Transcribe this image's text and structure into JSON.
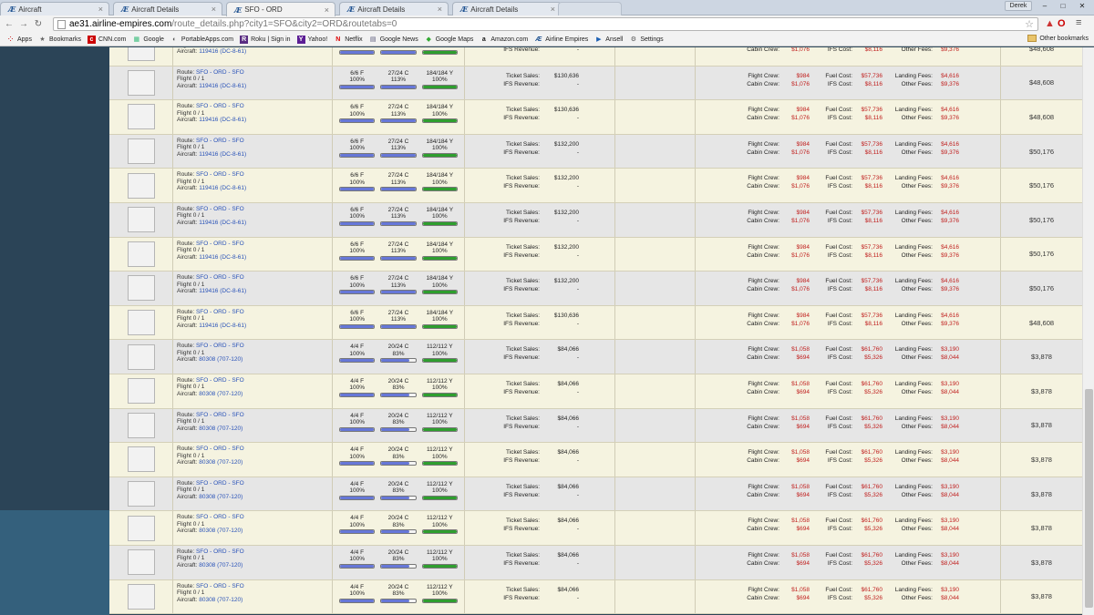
{
  "tabs": [
    {
      "label": "Aircraft",
      "active": false
    },
    {
      "label": "Aircraft Details",
      "active": false
    },
    {
      "label": "SFO - ORD",
      "active": true
    },
    {
      "label": "Aircraft Details",
      "active": false
    },
    {
      "label": "Aircraft Details",
      "active": false
    }
  ],
  "window": {
    "user": "Derek",
    "minimize": "–",
    "maximize": "□",
    "close": "✕"
  },
  "address": {
    "host": "ae31.airline-empires.com",
    "path": "/route_details.php?city1=SFO&city2=ORD&routetabs=0"
  },
  "bookmarks": [
    {
      "label": "Apps",
      "icon": "apps-icon"
    },
    {
      "label": "Bookmarks",
      "icon": "star-icon"
    },
    {
      "label": "CNN.com",
      "icon": "cnn-icon"
    },
    {
      "label": "Google",
      "icon": "google-icon"
    },
    {
      "label": "PortableApps.com",
      "icon": "portableapps-icon"
    },
    {
      "label": "Roku | Sign in",
      "icon": "roku-icon"
    },
    {
      "label": "Yahoo!",
      "icon": "yahoo-icon"
    },
    {
      "label": "Netflix",
      "icon": "netflix-icon"
    },
    {
      "label": "Google News",
      "icon": "news-icon"
    },
    {
      "label": "Google Maps",
      "icon": "maps-icon"
    },
    {
      "label": "Amazon.com",
      "icon": "amazon-icon"
    },
    {
      "label": "Airline Empires",
      "icon": "ae-icon"
    },
    {
      "label": "Ansell",
      "icon": "ansell-icon"
    },
    {
      "label": "Settings",
      "icon": "gear-icon"
    }
  ],
  "other_bookmarks": "Other bookmarks",
  "labels": {
    "route": "Route:",
    "flight": "Flight",
    "aircraft": "Aircraft:",
    "ticket_sales": "Ticket Sales:",
    "ifs_revenue": "IFS Revenue:",
    "flight_crew": "Flight Crew:",
    "cabin_crew": "Cabin Crew:",
    "fuel_cost": "Fuel Cost:",
    "ifs_cost": "IFS Cost:",
    "landing_fees": "Landing Fees:",
    "other_fees": "Other Fees:"
  },
  "rows": [
    {
      "route": "SFO - ORD - SFO",
      "flight": "0 / 1",
      "aircraft": "119416 (DC-8-61)",
      "f": "6/6 F",
      "c": "27/24 C",
      "y": "184/184 Y",
      "fp": "100%",
      "cp": "113%",
      "yp": "100%",
      "fv": 1.0,
      "cv": 1.13,
      "yv": 1.0,
      "ticket": "$130,636",
      "ifs": "-",
      "fcrew": "$984",
      "ccrew": "$1,076",
      "fuel": "$57,736",
      "ifscost": "$8,116",
      "landing": "$4,616",
      "other": "$9,376",
      "profit": "$48,608"
    },
    {
      "route": "SFO - ORD - SFO",
      "flight": "0 / 1",
      "aircraft": "119416 (DC-8-61)",
      "f": "6/6 F",
      "c": "27/24 C",
      "y": "184/184 Y",
      "fp": "100%",
      "cp": "113%",
      "yp": "100%",
      "fv": 1.0,
      "cv": 1.13,
      "yv": 1.0,
      "ticket": "$130,636",
      "ifs": "-",
      "fcrew": "$984",
      "ccrew": "$1,076",
      "fuel": "$57,736",
      "ifscost": "$8,116",
      "landing": "$4,616",
      "other": "$9,376",
      "profit": "$48,608"
    },
    {
      "route": "SFO - ORD - SFO",
      "flight": "0 / 1",
      "aircraft": "119416 (DC-8-61)",
      "f": "6/6 F",
      "c": "27/24 C",
      "y": "184/184 Y",
      "fp": "100%",
      "cp": "113%",
      "yp": "100%",
      "fv": 1.0,
      "cv": 1.13,
      "yv": 1.0,
      "ticket": "$130,636",
      "ifs": "-",
      "fcrew": "$984",
      "ccrew": "$1,076",
      "fuel": "$57,736",
      "ifscost": "$8,116",
      "landing": "$4,616",
      "other": "$9,376",
      "profit": "$48,608"
    },
    {
      "route": "SFO - ORD - SFO",
      "flight": "0 / 1",
      "aircraft": "119416 (DC-8-61)",
      "f": "6/6 F",
      "c": "27/24 C",
      "y": "184/184 Y",
      "fp": "100%",
      "cp": "113%",
      "yp": "100%",
      "fv": 1.0,
      "cv": 1.13,
      "yv": 1.0,
      "ticket": "$132,200",
      "ifs": "-",
      "fcrew": "$984",
      "ccrew": "$1,076",
      "fuel": "$57,736",
      "ifscost": "$8,116",
      "landing": "$4,616",
      "other": "$9,376",
      "profit": "$50,176"
    },
    {
      "route": "SFO - ORD - SFO",
      "flight": "0 / 1",
      "aircraft": "119416 (DC-8-61)",
      "f": "6/6 F",
      "c": "27/24 C",
      "y": "184/184 Y",
      "fp": "100%",
      "cp": "113%",
      "yp": "100%",
      "fv": 1.0,
      "cv": 1.13,
      "yv": 1.0,
      "ticket": "$132,200",
      "ifs": "-",
      "fcrew": "$984",
      "ccrew": "$1,076",
      "fuel": "$57,736",
      "ifscost": "$8,116",
      "landing": "$4,616",
      "other": "$9,376",
      "profit": "$50,176"
    },
    {
      "route": "SFO - ORD - SFO",
      "flight": "0 / 1",
      "aircraft": "119416 (DC-8-61)",
      "f": "6/6 F",
      "c": "27/24 C",
      "y": "184/184 Y",
      "fp": "100%",
      "cp": "113%",
      "yp": "100%",
      "fv": 1.0,
      "cv": 1.13,
      "yv": 1.0,
      "ticket": "$132,200",
      "ifs": "-",
      "fcrew": "$984",
      "ccrew": "$1,076",
      "fuel": "$57,736",
      "ifscost": "$8,116",
      "landing": "$4,616",
      "other": "$9,376",
      "profit": "$50,176"
    },
    {
      "route": "SFO - ORD - SFO",
      "flight": "0 / 1",
      "aircraft": "119416 (DC-8-61)",
      "f": "6/6 F",
      "c": "27/24 C",
      "y": "184/184 Y",
      "fp": "100%",
      "cp": "113%",
      "yp": "100%",
      "fv": 1.0,
      "cv": 1.13,
      "yv": 1.0,
      "ticket": "$132,200",
      "ifs": "-",
      "fcrew": "$984",
      "ccrew": "$1,076",
      "fuel": "$57,736",
      "ifscost": "$8,116",
      "landing": "$4,616",
      "other": "$9,376",
      "profit": "$50,176"
    },
    {
      "route": "SFO - ORD - SFO",
      "flight": "0 / 1",
      "aircraft": "119416 (DC-8-61)",
      "f": "6/6 F",
      "c": "27/24 C",
      "y": "184/184 Y",
      "fp": "100%",
      "cp": "113%",
      "yp": "100%",
      "fv": 1.0,
      "cv": 1.13,
      "yv": 1.0,
      "ticket": "$132,200",
      "ifs": "-",
      "fcrew": "$984",
      "ccrew": "$1,076",
      "fuel": "$57,736",
      "ifscost": "$8,116",
      "landing": "$4,616",
      "other": "$9,376",
      "profit": "$50,176"
    },
    {
      "route": "SFO - ORD - SFO",
      "flight": "0 / 1",
      "aircraft": "119416 (DC-8-61)",
      "f": "6/6 F",
      "c": "27/24 C",
      "y": "184/184 Y",
      "fp": "100%",
      "cp": "113%",
      "yp": "100%",
      "fv": 1.0,
      "cv": 1.13,
      "yv": 1.0,
      "ticket": "$130,636",
      "ifs": "-",
      "fcrew": "$984",
      "ccrew": "$1,076",
      "fuel": "$57,736",
      "ifscost": "$8,116",
      "landing": "$4,616",
      "other": "$9,376",
      "profit": "$48,608"
    },
    {
      "route": "SFO - ORD - SFO",
      "flight": "0 / 1",
      "aircraft": "80308 (707-120)",
      "f": "4/4 F",
      "c": "20/24 C",
      "y": "112/112 Y",
      "fp": "100%",
      "cp": "83%",
      "yp": "100%",
      "fv": 1.0,
      "cv": 0.83,
      "yv": 1.0,
      "ticket": "$84,066",
      "ifs": "-",
      "fcrew": "$1,058",
      "ccrew": "$694",
      "fuel": "$61,760",
      "ifscost": "$5,326",
      "landing": "$3,190",
      "other": "$8,044",
      "profit": "$3,878"
    },
    {
      "route": "SFO - ORD - SFO",
      "flight": "0 / 1",
      "aircraft": "80308 (707-120)",
      "f": "4/4 F",
      "c": "20/24 C",
      "y": "112/112 Y",
      "fp": "100%",
      "cp": "83%",
      "yp": "100%",
      "fv": 1.0,
      "cv": 0.83,
      "yv": 1.0,
      "ticket": "$84,066",
      "ifs": "-",
      "fcrew": "$1,058",
      "ccrew": "$694",
      "fuel": "$61,760",
      "ifscost": "$5,326",
      "landing": "$3,190",
      "other": "$8,044",
      "profit": "$3,878"
    },
    {
      "route": "SFO - ORD - SFO",
      "flight": "0 / 1",
      "aircraft": "80308 (707-120)",
      "f": "4/4 F",
      "c": "20/24 C",
      "y": "112/112 Y",
      "fp": "100%",
      "cp": "83%",
      "yp": "100%",
      "fv": 1.0,
      "cv": 0.83,
      "yv": 1.0,
      "ticket": "$84,066",
      "ifs": "-",
      "fcrew": "$1,058",
      "ccrew": "$694",
      "fuel": "$61,760",
      "ifscost": "$5,326",
      "landing": "$3,190",
      "other": "$8,044",
      "profit": "$3,878"
    },
    {
      "route": "SFO - ORD - SFO",
      "flight": "0 / 1",
      "aircraft": "80308 (707-120)",
      "f": "4/4 F",
      "c": "20/24 C",
      "y": "112/112 Y",
      "fp": "100%",
      "cp": "83%",
      "yp": "100%",
      "fv": 1.0,
      "cv": 0.83,
      "yv": 1.0,
      "ticket": "$84,066",
      "ifs": "-",
      "fcrew": "$1,058",
      "ccrew": "$694",
      "fuel": "$61,760",
      "ifscost": "$5,326",
      "landing": "$3,190",
      "other": "$8,044",
      "profit": "$3,878"
    },
    {
      "route": "SFO - ORD - SFO",
      "flight": "0 / 1",
      "aircraft": "80308 (707-120)",
      "f": "4/4 F",
      "c": "20/24 C",
      "y": "112/112 Y",
      "fp": "100%",
      "cp": "83%",
      "yp": "100%",
      "fv": 1.0,
      "cv": 0.83,
      "yv": 1.0,
      "ticket": "$84,066",
      "ifs": "-",
      "fcrew": "$1,058",
      "ccrew": "$694",
      "fuel": "$61,760",
      "ifscost": "$5,326",
      "landing": "$3,190",
      "other": "$8,044",
      "profit": "$3,878"
    },
    {
      "route": "SFO - ORD - SFO",
      "flight": "0 / 1",
      "aircraft": "80308 (707-120)",
      "f": "4/4 F",
      "c": "20/24 C",
      "y": "112/112 Y",
      "fp": "100%",
      "cp": "83%",
      "yp": "100%",
      "fv": 1.0,
      "cv": 0.83,
      "yv": 1.0,
      "ticket": "$84,066",
      "ifs": "-",
      "fcrew": "$1,058",
      "ccrew": "$694",
      "fuel": "$61,760",
      "ifscost": "$5,326",
      "landing": "$3,190",
      "other": "$8,044",
      "profit": "$3,878"
    },
    {
      "route": "SFO - ORD - SFO",
      "flight": "0 / 1",
      "aircraft": "80308 (707-120)",
      "f": "4/4 F",
      "c": "20/24 C",
      "y": "112/112 Y",
      "fp": "100%",
      "cp": "83%",
      "yp": "100%",
      "fv": 1.0,
      "cv": 0.83,
      "yv": 1.0,
      "ticket": "$84,066",
      "ifs": "-",
      "fcrew": "$1,058",
      "ccrew": "$694",
      "fuel": "$61,760",
      "ifscost": "$5,326",
      "landing": "$3,190",
      "other": "$8,044",
      "profit": "$3,878"
    },
    {
      "route": "SFO - ORD - SFO",
      "flight": "0 / 1",
      "aircraft": "80308 (707-120)",
      "f": "4/4 F",
      "c": "20/24 C",
      "y": "112/112 Y",
      "fp": "100%",
      "cp": "83%",
      "yp": "100%",
      "fv": 1.0,
      "cv": 0.83,
      "yv": 1.0,
      "ticket": "$84,066",
      "ifs": "-",
      "fcrew": "$1,058",
      "ccrew": "$694",
      "fuel": "$61,760",
      "ifscost": "$5,326",
      "landing": "$3,190",
      "other": "$8,044",
      "profit": "$3,878"
    }
  ]
}
